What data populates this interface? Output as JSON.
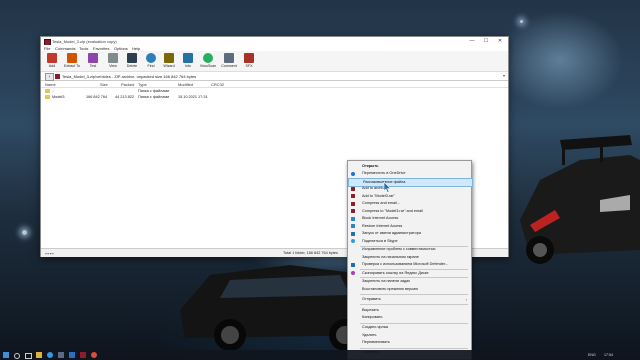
{
  "window": {
    "title": "Tesla_Model_3.zip (evaluation copy)",
    "controls": {
      "minimize": "—",
      "maximize": "☐",
      "close": "✕"
    }
  },
  "menu": [
    "File",
    "Commands",
    "Tools",
    "Favorites",
    "Options",
    "Help"
  ],
  "toolbar": [
    {
      "label": "Add",
      "icon": "add-icon",
      "color": "#c0392b"
    },
    {
      "label": "Extract To",
      "icon": "extract-icon",
      "color": "#d35400"
    },
    {
      "label": "Test",
      "icon": "test-icon",
      "color": "#8e44ad"
    },
    {
      "label": "View",
      "icon": "view-icon",
      "color": "#7f8c8d"
    },
    {
      "label": "Delete",
      "icon": "delete-icon",
      "color": "#2c3e50"
    },
    {
      "label": "Find",
      "icon": "find-icon",
      "color": "#2980b9"
    },
    {
      "label": "Wizard",
      "icon": "wizard-icon",
      "color": "#7d6608"
    },
    {
      "label": "Info",
      "icon": "info-icon",
      "color": "#2471a3"
    },
    {
      "label": "VirusScan",
      "icon": "virusscan-icon",
      "color": "#27ae60"
    },
    {
      "label": "Comment",
      "icon": "comment-icon",
      "color": "#5d6d7e"
    },
    {
      "label": "SFX",
      "icon": "sfx-icon",
      "color": "#a93226"
    }
  ],
  "address": {
    "up": "↑",
    "path": "Tesla_Model_3.zip\\vehicles - ZIP archive, unpacked size 166 842 764 bytes"
  },
  "columns": [
    "Name",
    "Size",
    "Packed",
    "Type",
    "Modified",
    "CRC32"
  ],
  "rows": [
    {
      "name": "..",
      "size": "",
      "packed": "",
      "type": "Папка с файлами",
      "modified": ""
    },
    {
      "name": "Model3",
      "size": "166 842 764",
      "packed": "44 213 822",
      "type": "Папка с файлами",
      "modified": "15.10.2021 17:31"
    }
  ],
  "status": {
    "left": "⊶ ⊷",
    "right": "Total 1 folder, 166 842 764 bytes"
  },
  "context_menu": [
    {
      "label": "Открыть",
      "icon": "",
      "bold": true
    },
    {
      "label": "Переместить в OneDrive",
      "icon": "onedrive-icon",
      "color": "#1e6fd0"
    },
    {
      "label": "Распаковывание файла",
      "icon": "",
      "highlight": true
    },
    {
      "label": "Add to archive...",
      "icon": "winrar-icon",
      "color": "#8b1d2c"
    },
    {
      "label": "Add to \"Model3.rar\"",
      "icon": "winrar-icon",
      "color": "#8b1d2c"
    },
    {
      "label": "Compress and email...",
      "icon": "winrar-icon",
      "color": "#8b1d2c"
    },
    {
      "label": "Compress to \"Model3.rar\" and email",
      "icon": "winrar-icon",
      "color": "#8b1d2c"
    },
    {
      "label": "Block Internet Access",
      "icon": "block-icon",
      "color": "#2e86c1"
    },
    {
      "label": "Restore Internet Access",
      "icon": "restore-icon",
      "color": "#2e86c1"
    },
    {
      "label": "Запуск от имени администратора",
      "icon": "shield-icon",
      "color": "#2471a3"
    },
    {
      "label": "Поделиться в Skype",
      "icon": "skype-icon",
      "color": "#2e9ee0"
    },
    {
      "label": "Исправление проблем с совместимостью",
      "icon": "",
      "sep_before": true
    },
    {
      "label": "Закрепить на начальном экране",
      "icon": ""
    },
    {
      "label": "Проверка с использованием Microsoft Defender...",
      "icon": "defender-icon",
      "color": "#1f6fb2"
    },
    {
      "label": "Скопировать ссылку на Яндекс Диске",
      "icon": "yandex-icon",
      "color": "#b03ab8",
      "sep_before": true
    },
    {
      "label": "Закрепить на панели задач",
      "icon": "",
      "sep_before": true
    },
    {
      "label": "Восстановить прежнюю версию",
      "icon": ""
    },
    {
      "label": "Отправить",
      "icon": "",
      "submenu": true,
      "sep_before": true
    },
    {
      "label": "Вырезать",
      "icon": "",
      "sep_before": true
    },
    {
      "label": "Копировать",
      "icon": ""
    },
    {
      "label": "Создать ярлык",
      "icon": "",
      "sep_before": true
    },
    {
      "label": "Удалить",
      "icon": ""
    },
    {
      "label": "Переименовать",
      "icon": ""
    },
    {
      "label": "Свойства",
      "icon": "",
      "sep_before": true
    }
  ],
  "taskbar": {
    "items": [
      "start-icon",
      "search-icon",
      "taskview-icon",
      "explorer-icon",
      "edge-icon",
      "store-icon",
      "mail-icon",
      "winrar-icon",
      "chrome-icon"
    ],
    "lang": "ENG",
    "time": "17:54"
  }
}
